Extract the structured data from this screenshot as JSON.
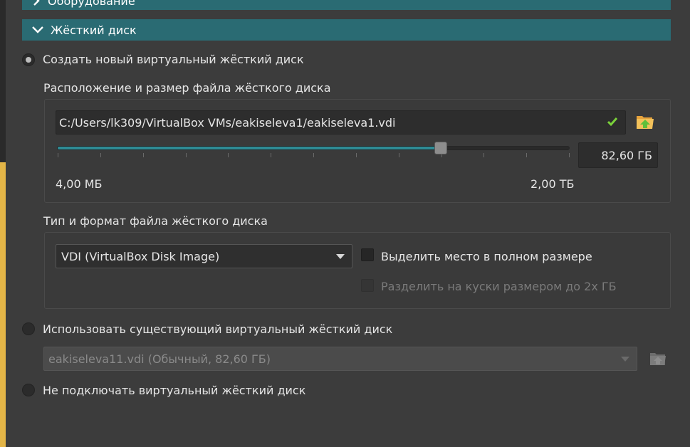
{
  "sections": {
    "hardware": {
      "label": "Оборудование",
      "expanded": false
    },
    "hard_disk": {
      "label": "Жёсткий диск",
      "expanded": true
    }
  },
  "option_create": {
    "label": "Создать новый виртуальный жёсткий диск",
    "selected": true,
    "location_group_label": "Расположение и размер файла жёсткого диска",
    "path_value": "C:/Users/lk309/VirtualBox VMs/eakiseleva1/eakiseleva1.vdi",
    "size_value": "82,60 ГБ",
    "size_fraction": 0.749,
    "min_label": "4,00 МБ",
    "max_label": "2,00 ТБ",
    "type_group_label": "Тип и формат файла жёсткого диска",
    "format_selected": "VDI (VirtualBox Disk Image)",
    "preallocate_label": "Выделить место в полном размере",
    "preallocate_checked": false,
    "split_label": "Разделить на куски размером до 2х ГБ",
    "split_checked": false,
    "split_enabled": false
  },
  "option_existing": {
    "label": "Использовать существующий виртуальный жёсткий диск",
    "selected": false,
    "disk_selected": "eakiseleva11.vdi (Обычный, 82,60 ГБ)"
  },
  "option_none": {
    "label": "Не подключать виртуальный жёсткий диск",
    "selected": false
  },
  "colors": {
    "section_header": "#2a6b73",
    "slider_fill": "#2e8c96",
    "background": "#3c3c3c",
    "left_accent": "#e3b547"
  },
  "icons": {
    "collapse": "chevron-right-icon",
    "expand": "chevron-down-icon",
    "valid": "checkmark-icon",
    "folder": "folder-open-icon",
    "dropdown": "triangle-down-icon"
  }
}
